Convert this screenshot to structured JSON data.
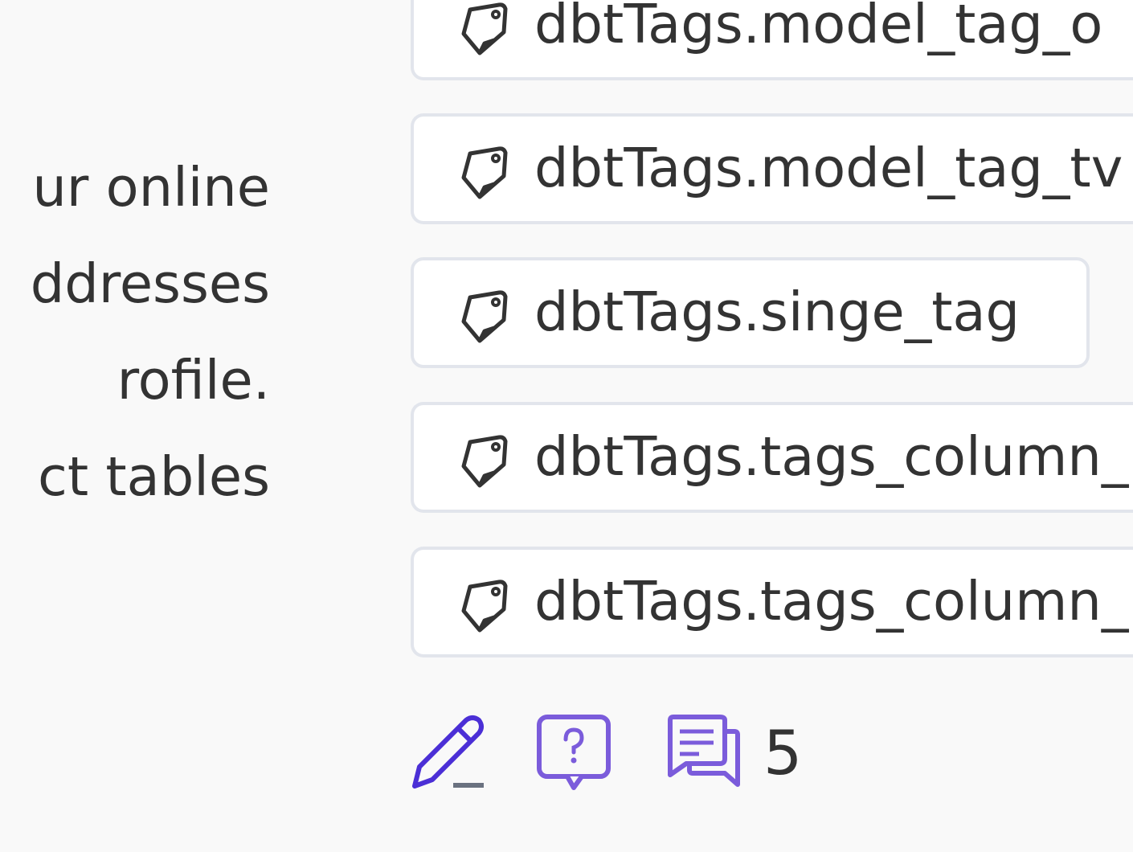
{
  "description": {
    "lines": [
      "ur online",
      "ddresses",
      "rofile.",
      "ct tables"
    ]
  },
  "tags": [
    {
      "label": "dbtTags.model_tag_o",
      "icon": "tag-icon"
    },
    {
      "label": "dbtTags.model_tag_tv",
      "icon": "tag-icon"
    },
    {
      "label": "dbtTags.singe_tag",
      "icon": "tag-icon"
    },
    {
      "label": "dbtTags.tags_column_",
      "icon": "tag-icon"
    },
    {
      "label": "dbtTags.tags_column_",
      "icon": "tag-icon"
    }
  ],
  "actions": {
    "edit": {
      "icon": "pencil-edit-icon"
    },
    "request": {
      "icon": "question-bubble-icon"
    },
    "conversations": {
      "icon": "conversation-icon",
      "count": "5"
    }
  },
  "colors": {
    "accent": "#4b2fd6",
    "accent_light": "#7b5cdb",
    "tag_border": "#e2e5ec",
    "text": "#333333",
    "background": "#f9f9f9"
  }
}
